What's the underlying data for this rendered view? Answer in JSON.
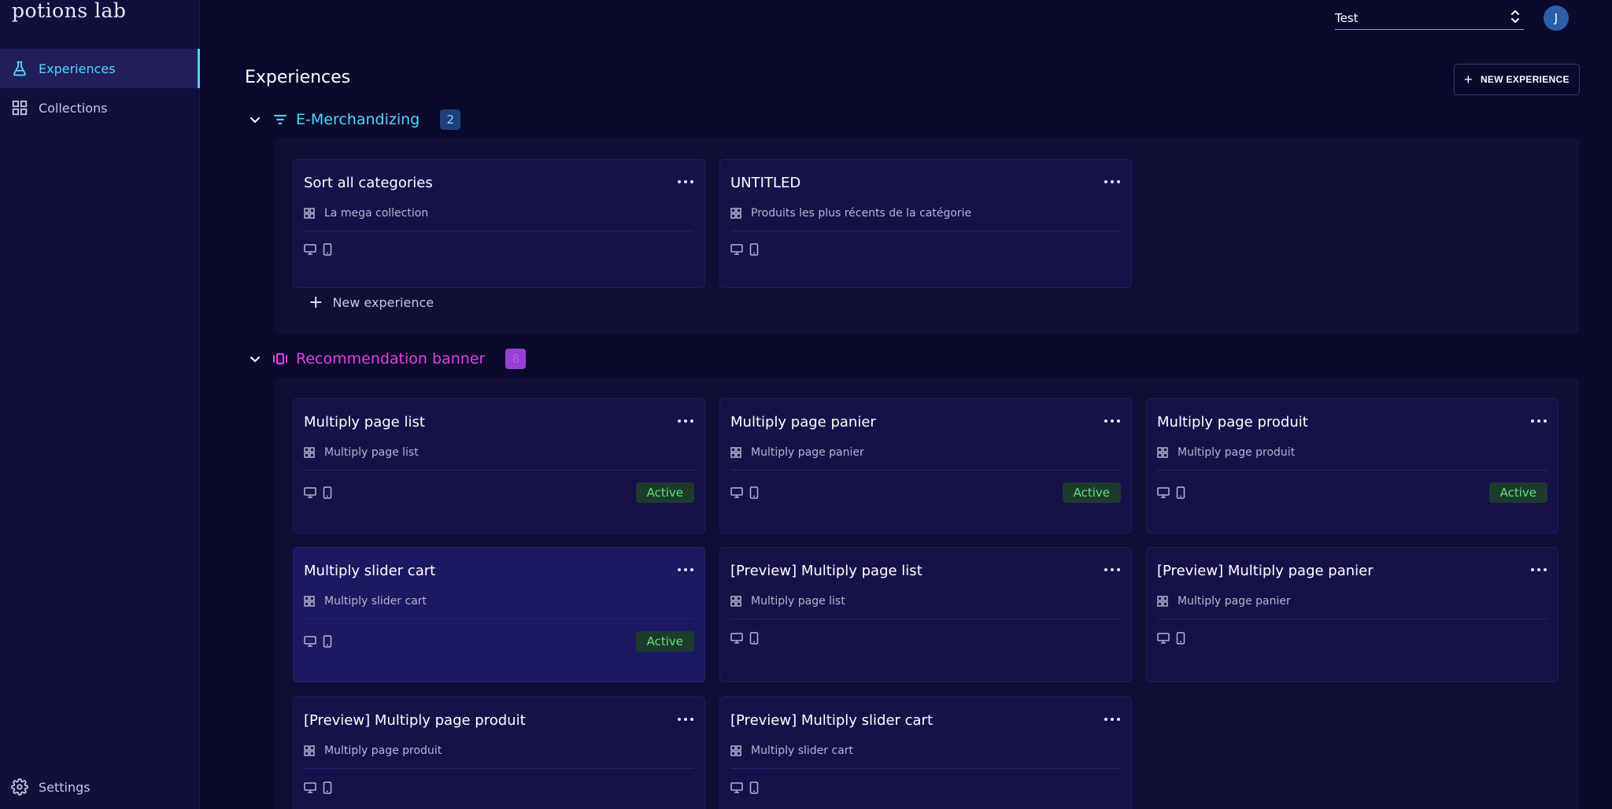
{
  "brand": {
    "logo_text": "potions lab"
  },
  "sidebar": {
    "items": [
      {
        "label": "Experiences",
        "icon": "flask-icon",
        "active": true
      },
      {
        "label": "Collections",
        "icon": "grid-icon",
        "active": false
      }
    ],
    "settings_label": "Settings"
  },
  "header": {
    "workspace": "Test",
    "avatar_initial": "J"
  },
  "main": {
    "title": "Experiences",
    "new_button_label": "NEW EXPERIENCE",
    "groups": [
      {
        "name": "E-Merchandizing",
        "count": "2",
        "color": "#4fd7ff",
        "badge_bg": "#1d3f7a",
        "cards": [
          {
            "title": "Sort all categories",
            "collection": "La mega collection",
            "status": ""
          },
          {
            "title": "UNTITLED",
            "collection": "Produits les plus récents de la catégorie",
            "status": ""
          }
        ],
        "new_experience_label": "New experience"
      },
      {
        "name": "Recommendation banner",
        "count": "8",
        "color": "#e43ee8",
        "badge_bg": "#9a3fd6",
        "cards": [
          {
            "title": "Multiply page list",
            "collection": "Multiply page list",
            "status": "Active"
          },
          {
            "title": "Multiply page panier",
            "collection": "Multiply page panier",
            "status": "Active"
          },
          {
            "title": "Multiply page produit",
            "collection": "Multiply page produit",
            "status": "Active"
          },
          {
            "title": "Multiply slider cart",
            "collection": "Multiply slider cart",
            "status": "Active"
          },
          {
            "title": "[Preview] Multiply page list",
            "collection": "Multiply page list",
            "status": ""
          },
          {
            "title": "[Preview] Multiply page panier",
            "collection": "Multiply page panier",
            "status": ""
          },
          {
            "title": "[Preview] Multiply page produit",
            "collection": "Multiply page produit",
            "status": ""
          },
          {
            "title": "[Preview] Multiply slider cart",
            "collection": "Multiply slider cart",
            "status": ""
          }
        ]
      }
    ]
  }
}
